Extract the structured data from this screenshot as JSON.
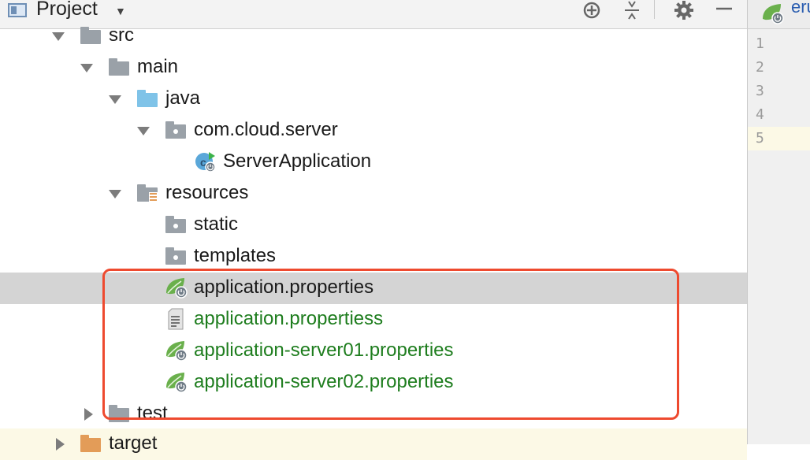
{
  "panel": {
    "title": "Project"
  },
  "tree": {
    "src": "src",
    "main": "main",
    "java": "java",
    "package": "com.cloud.server",
    "server_app": "ServerApplication",
    "resources": "resources",
    "static": "static",
    "templates": "templates",
    "file1": "application.properties",
    "file2": "application.propertiess",
    "file3": "application-server01.properties",
    "file4": "application-server02.properties",
    "test": "test",
    "target": "target"
  },
  "editor": {
    "tab_label": "eru",
    "line_numbers": [
      "1",
      "2",
      "3",
      "4",
      "5"
    ],
    "current_line": "5"
  },
  "colors": {
    "annotation_box": "#ee4a2f",
    "selected_row": "#d4d4d4",
    "untracked_file_text": "#1e7d1e",
    "spring_leaf": "#6ab04c"
  }
}
